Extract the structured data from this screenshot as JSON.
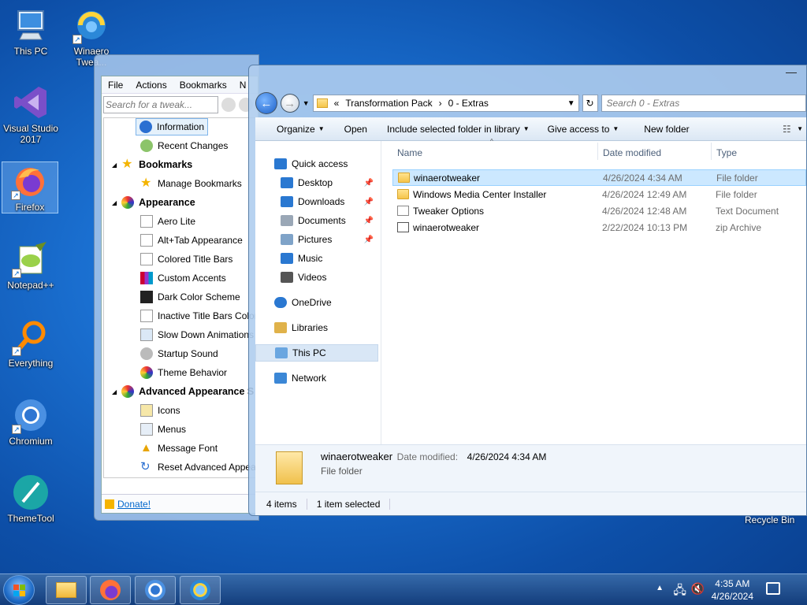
{
  "desktop": {
    "icons": [
      {
        "id": "this-pc",
        "label": "This PC"
      },
      {
        "id": "winaero",
        "label": "Winaero Twea..."
      },
      {
        "id": "visual-studio",
        "label": "Visual Studio 2017"
      },
      {
        "id": "firefox",
        "label": "Firefox"
      },
      {
        "id": "notepadpp",
        "label": "Notepad++"
      },
      {
        "id": "everything",
        "label": "Everything"
      },
      {
        "id": "chromium",
        "label": "Chromium"
      },
      {
        "id": "themetool",
        "label": "ThemeTool"
      }
    ],
    "recycle_bin": "Recycle Bin"
  },
  "winaero": {
    "menu": [
      "File",
      "Actions",
      "Bookmarks",
      "N"
    ],
    "search_placeholder": "Search for a tweak...",
    "tree": [
      {
        "label": "Information",
        "kind": "item",
        "selected": true
      },
      {
        "label": "Recent Changes",
        "kind": "item"
      },
      {
        "label": "Bookmarks",
        "kind": "header"
      },
      {
        "label": "Manage Bookmarks",
        "kind": "item"
      },
      {
        "label": "Appearance",
        "kind": "header"
      },
      {
        "label": "Aero Lite",
        "kind": "item"
      },
      {
        "label": "Alt+Tab Appearance",
        "kind": "item"
      },
      {
        "label": "Colored Title Bars",
        "kind": "item"
      },
      {
        "label": "Custom Accents",
        "kind": "item"
      },
      {
        "label": "Dark Color Scheme",
        "kind": "item"
      },
      {
        "label": "Inactive Title Bars Color",
        "kind": "item"
      },
      {
        "label": "Slow Down Animations",
        "kind": "item"
      },
      {
        "label": "Startup Sound",
        "kind": "item"
      },
      {
        "label": "Theme Behavior",
        "kind": "item"
      },
      {
        "label": "Advanced Appearance S",
        "kind": "header"
      },
      {
        "label": "Icons",
        "kind": "item"
      },
      {
        "label": "Menus",
        "kind": "item"
      },
      {
        "label": "Message Font",
        "kind": "item"
      },
      {
        "label": "Reset Advanced Appear",
        "kind": "item"
      }
    ],
    "donate": "Donate!"
  },
  "explorer": {
    "address": {
      "overflow": "«",
      "crumbs": [
        "Transformation Pack",
        "0 - Extras"
      ]
    },
    "search_placeholder": "Search 0 - Extras",
    "commands": [
      {
        "label": "Organize",
        "dropdown": true
      },
      {
        "label": "Open",
        "dropdown": false
      },
      {
        "label": "Include selected folder in library",
        "dropdown": true
      },
      {
        "label": "Give access to",
        "dropdown": true
      },
      {
        "label": "New folder",
        "dropdown": false
      }
    ],
    "nav": [
      {
        "label": "Quick access",
        "icon": "star-icon",
        "indent": 0,
        "pinned": false
      },
      {
        "label": "Desktop",
        "icon": "desktop-icon",
        "indent": 1,
        "pinned": true
      },
      {
        "label": "Downloads",
        "icon": "download-icon",
        "indent": 1,
        "pinned": true
      },
      {
        "label": "Documents",
        "icon": "documents-icon",
        "indent": 1,
        "pinned": true
      },
      {
        "label": "Pictures",
        "icon": "pictures-icon",
        "indent": 1,
        "pinned": true
      },
      {
        "label": "Music",
        "icon": "music-icon",
        "indent": 1,
        "pinned": false
      },
      {
        "label": "Videos",
        "icon": "videos-icon",
        "indent": 1,
        "pinned": false
      },
      {
        "label": "OneDrive",
        "icon": "cloud-icon",
        "indent": 0,
        "pinned": false
      },
      {
        "label": "Libraries",
        "icon": "library-icon",
        "indent": 0,
        "pinned": false
      },
      {
        "label": "This PC",
        "icon": "computer-icon",
        "indent": 0,
        "pinned": false,
        "selected": true
      },
      {
        "label": "Network",
        "icon": "network-icon",
        "indent": 0,
        "pinned": false
      }
    ],
    "columns": [
      "Name",
      "Date modified",
      "Type"
    ],
    "files": [
      {
        "name": "winaerotweaker",
        "date": "4/26/2024 4:34 AM",
        "type": "File folder",
        "icon": "folder",
        "selected": true
      },
      {
        "name": "Windows Media Center Installer",
        "date": "4/26/2024 12:49 AM",
        "type": "File folder",
        "icon": "folder"
      },
      {
        "name": "Tweaker Options",
        "date": "4/26/2024 12:48 AM",
        "type": "Text Document",
        "icon": "doc"
      },
      {
        "name": "winaerotweaker",
        "date": "2/22/2024 10:13 PM",
        "type": "zip Archive",
        "icon": "zip"
      }
    ],
    "details": {
      "name": "winaerotweaker",
      "date_label": "Date modified:",
      "date": "4/26/2024 4:34 AM",
      "type": "File folder"
    },
    "status": {
      "count": "4 items",
      "selected": "1 item selected"
    }
  },
  "taskbar": {
    "apps": [
      "file-explorer",
      "firefox",
      "chromium",
      "winaero-tweaker"
    ],
    "time": "4:35 AM",
    "date": "4/26/2024"
  }
}
